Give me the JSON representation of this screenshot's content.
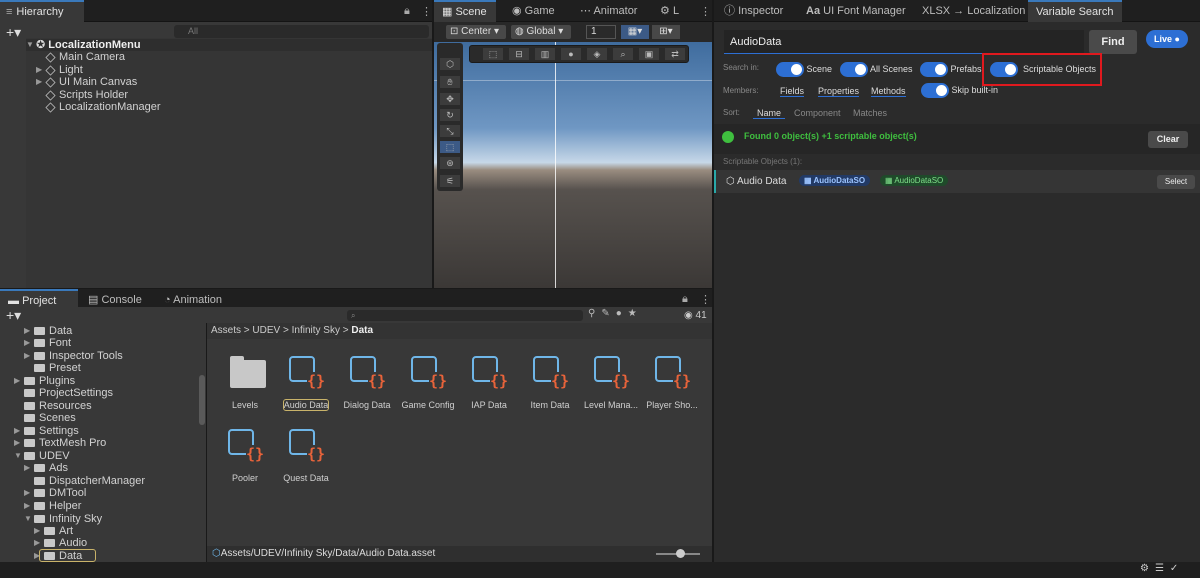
{
  "hierarchy": {
    "tab": "Hierarchy",
    "search_placeholder": "All",
    "root": "LocalizationMenu",
    "items": [
      "Main Camera",
      "Light",
      "UI Main Canvas",
      "Scripts Holder",
      "LocalizationManager"
    ]
  },
  "scene": {
    "tabs": [
      "Scene",
      "Game",
      "Animator",
      "L"
    ],
    "pivot": "Center",
    "space": "Global",
    "grid_value": "1"
  },
  "bottom_tabs": [
    "Project",
    "Console",
    "Animation"
  ],
  "project": {
    "tree": [
      "Data",
      "Font",
      "Inspector Tools",
      "Preset",
      "Plugins",
      "ProjectSettings",
      "Resources",
      "Scenes",
      "Settings",
      "TextMesh Pro",
      "UDEV",
      "Ads",
      "DispatcherManager",
      "DMTool",
      "Helper",
      "Infinity Sky",
      "Art",
      "Audio",
      "Data"
    ],
    "breadcrumb": [
      "Assets",
      "UDEV",
      "Infinity Sky",
      "Data"
    ],
    "hidden_count": "41",
    "assets": [
      "Levels",
      "Audio Data",
      "Dialog Data",
      "Game Config",
      "IAP Data",
      "Item Data",
      "Level Mana...",
      "Player Sho...",
      "Pooler",
      "Quest Data"
    ],
    "status_path": "Assets/UDEV/Infinity Sky/Data/Audio Data.asset"
  },
  "right_tabs": [
    "Inspector",
    "UI Font Manager",
    "XLSX → Localization",
    "Variable Search"
  ],
  "search": {
    "query": "AudioData",
    "find_label": "Find",
    "live_label": "Live",
    "search_in_label": "Search in:",
    "scene": "Scene",
    "all_scenes": "All Scenes",
    "prefabs": "Prefabs",
    "scriptable": "Scriptable Objects",
    "members_label": "Members:",
    "fields": "Fields",
    "properties": "Properties",
    "methods": "Methods",
    "skip_builtin": "Skip built-in",
    "sort_label": "Sort:",
    "sort_name": "Name",
    "sort_component": "Component",
    "sort_matches": "Matches",
    "result_text": "Found 0 object(s)  +1 scriptable object(s)",
    "clear_label": "Clear",
    "section": "Scriptable Objects (1):",
    "row_name": "Audio Data",
    "badge1": "AudioDataSO",
    "badge2": "AudioDataSO",
    "select_label": "Select"
  },
  "colors": {
    "accent": "#2d6fd4",
    "highlight": "#e0191e",
    "green": "#3fbf3f"
  }
}
